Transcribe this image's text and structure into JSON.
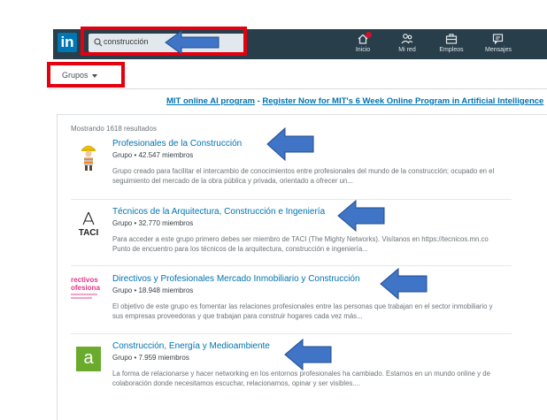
{
  "header": {
    "logo_text": "in",
    "search_value": "construcción",
    "nav": [
      {
        "label": "Inicio",
        "icon": "home-icon"
      },
      {
        "label": "Mi red",
        "icon": "network-icon"
      },
      {
        "label": "Empleos",
        "icon": "briefcase-icon"
      },
      {
        "label": "Mensajes",
        "icon": "messaging-icon"
      }
    ]
  },
  "filter": {
    "label": "Grupos"
  },
  "ad": {
    "link": "MIT online AI program",
    "separator": " - ",
    "text": "Register Now for MIT's 6 Week Online Program in Artificial Intelligence"
  },
  "results": {
    "count_label": "Mostrando 1618 resultados",
    "items": [
      {
        "title": "Profesionales de la Construcción",
        "meta": "Grupo • 42.547 miembros",
        "desc": "Grupo creado para facilitar el intercambio de conocimientos entre profesionales del mundo de la construcción; ocupado en el seguimiento del mercado de la obra pública y privada, orientado a ofrecer un..."
      },
      {
        "title": "Técnicos de la Arquitectura, Construcción e Ingeniería",
        "meta": "Grupo • 32.770 miembros",
        "thumb_text": "TACI",
        "desc": "Para acceder a este grupo primero debes ser miembro de TACI (The Mighty Networks). Visítanos en https://tecnicos.mn.co Punto de encuentro para los técnicos de la arquitectura, construcción e ingeniería..."
      },
      {
        "title": "Directivos y Profesionales Mercado Inmobiliario y Construcción",
        "meta": "Grupo • 18.948 miembros",
        "thumb_line1": "rectivos",
        "thumb_line2": "ofesiona",
        "desc": "El objetivo de este grupo es fomentar las relaciones profesionales entre las personas que trabajan en el sector inmobiliario y sus empresas proveedoras y que trabajan para construir hogares cada vez más..."
      },
      {
        "title": "Construcción, Energía y Medioambiente",
        "meta": "Grupo • 7.959 miembros",
        "thumb_text": "a",
        "desc": "La forma de relacionarse y hacer networking en los entornos profesionales ha cambiado. Estamos en un mundo online y de colaboración donde necesitamos escuchar, relacionarnos, opinar y ser visibles...."
      }
    ]
  },
  "colors": {
    "nav_bg": "#283e4a",
    "link": "#0073b1",
    "annotation_red": "#e3000f",
    "annotation_arrow": "#3f74c6",
    "thumb_green": "#6aab2e",
    "thumb_pink": "#e0388a"
  }
}
